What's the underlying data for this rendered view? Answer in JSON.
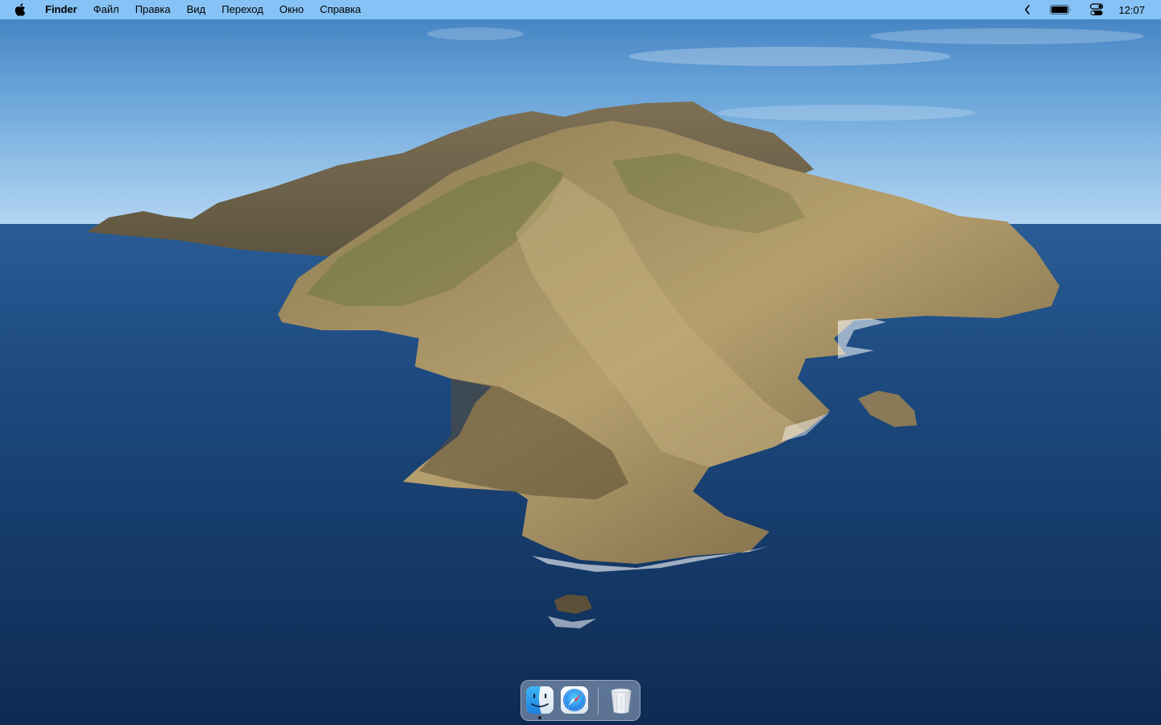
{
  "menubar": {
    "app_name": "Finder",
    "menus": [
      "Файл",
      "Правка",
      "Вид",
      "Переход",
      "Окно",
      "Справка"
    ],
    "clock": "12:07",
    "icons": {
      "apple": "apple-logo-icon",
      "chevron": "chevron-left-icon",
      "battery": "battery-icon",
      "control_center": "control-center-icon"
    }
  },
  "dock": {
    "apps": [
      {
        "name": "Finder",
        "icon": "finder-icon",
        "running": true
      },
      {
        "name": "Safari",
        "icon": "safari-icon",
        "running": false
      },
      {
        "name": "Trash",
        "icon": "trash-icon",
        "running": false
      }
    ]
  },
  "colors": {
    "menubar": "#8cc8fa",
    "sea": "#173f70",
    "sky": "#6aa5da"
  },
  "wallpaper": "Catalina island wallpaper"
}
